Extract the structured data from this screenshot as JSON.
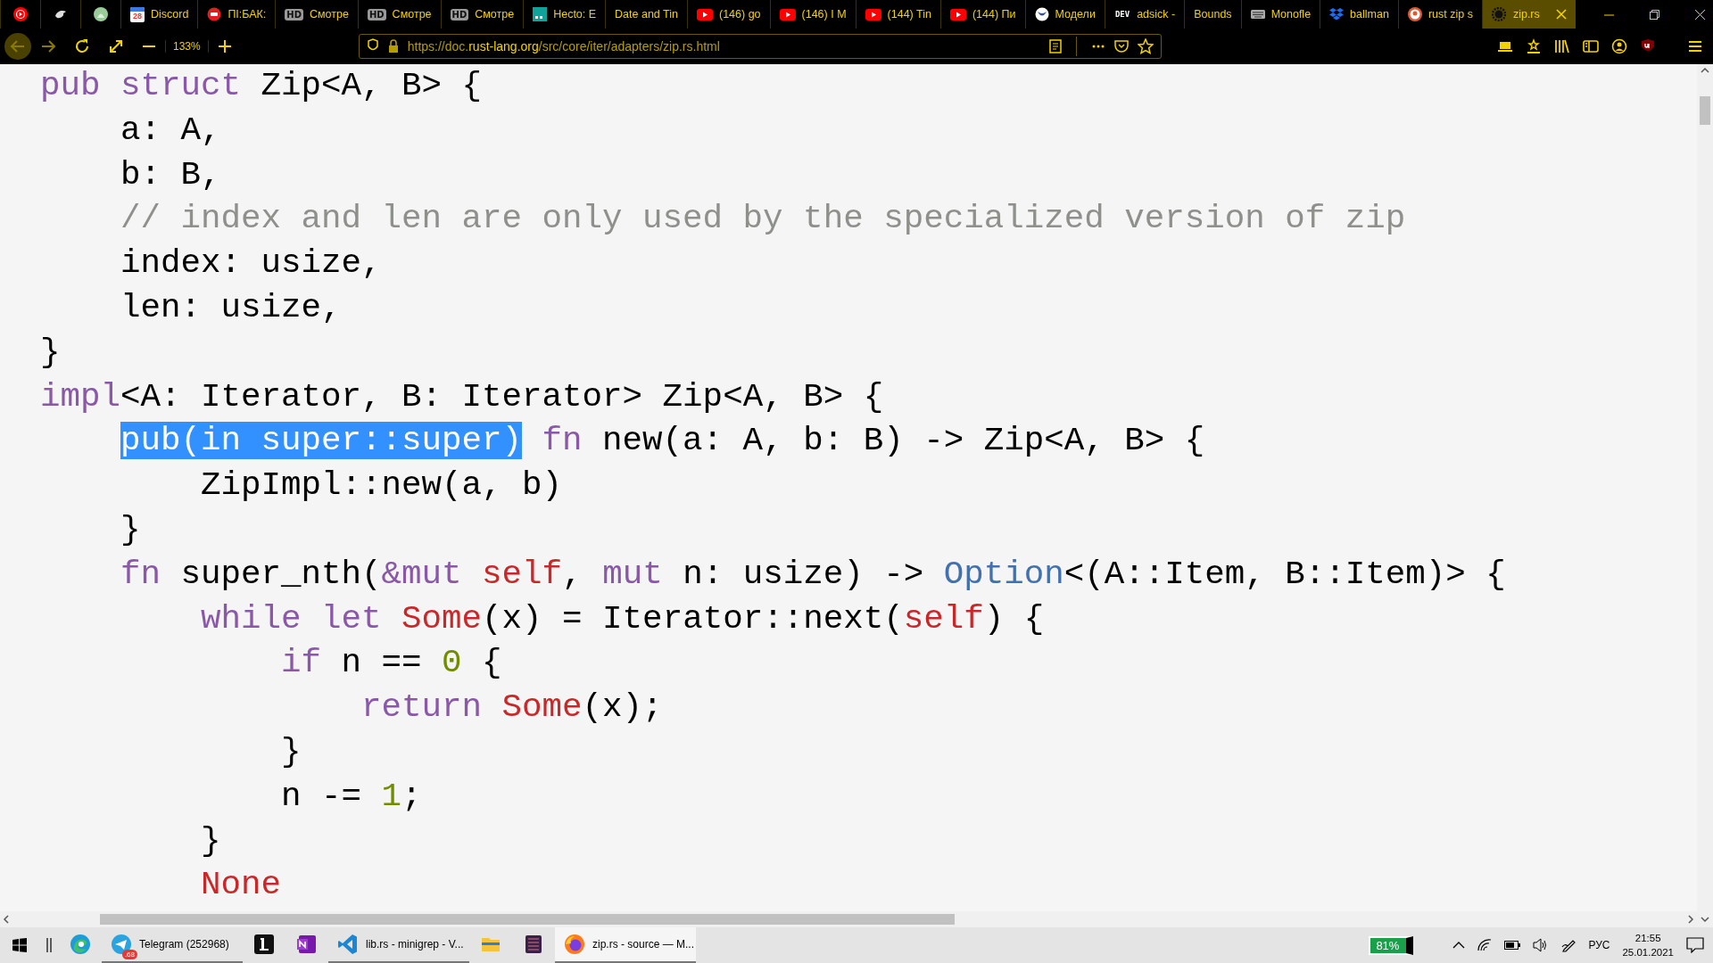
{
  "tabs": [
    {
      "selected": false
    },
    {
      "selected": false
    },
    {
      "selected": false
    },
    {
      "icon_text": "28",
      "title": "Discord",
      "selected": false
    },
    {
      "title": "ПІ:БАК:",
      "selected": false
    },
    {
      "icon_text": "HD",
      "title": "Смотре",
      "selected": false
    },
    {
      "icon_text": "HD",
      "title": "Смотре",
      "selected": false
    },
    {
      "icon_text": "HD",
      "title": "Смотре",
      "selected": false
    },
    {
      "title": "Hecto: E",
      "selected": false
    },
    {
      "title": "Date and Tin",
      "selected": false
    },
    {
      "title": "(146) go",
      "selected": false
    },
    {
      "title": "(146) I M",
      "selected": false
    },
    {
      "title": "(144) Tin",
      "selected": false
    },
    {
      "title": "(144) Пи",
      "selected": false
    },
    {
      "title": "Модели",
      "selected": false
    },
    {
      "icon_text": "DEV",
      "title": "adsick -",
      "selected": false
    },
    {
      "title": "Bounds",
      "selected": false
    },
    {
      "title": "Monofle",
      "selected": false
    },
    {
      "title": "ballman",
      "selected": false
    },
    {
      "title": "rust zip s",
      "selected": false
    },
    {
      "title": "zip.rs",
      "selected": true
    }
  ],
  "nav": {
    "zoom": "133%",
    "url_scheme": "https://doc.",
    "url_domain": "rust-lang.org",
    "url_path": "/src/core/iter/adapters/zip.rs.html"
  },
  "code": [
    {
      "tokens": [
        {
          "kind": "keyword",
          "text": "pub"
        },
        {
          "kind": "keyword",
          "text": " struct"
        },
        {
          "kind": "plain",
          "text": " Zip<A, B> {"
        }
      ],
      "children": [
        {
          "tokens": [
            {
              "kind": "plain",
              "text": "a: A,"
            }
          ]
        },
        {
          "tokens": [
            {
              "kind": "plain",
              "text": "b: B,"
            }
          ]
        },
        {
          "tokens": [
            {
              "kind": "comment",
              "text": "// index and len are only used by the specialized version of zip"
            }
          ]
        },
        {
          "tokens": [
            {
              "kind": "plain",
              "text": "index: usize,"
            }
          ]
        },
        {
          "tokens": [
            {
              "kind": "plain",
              "text": "len: usize,"
            }
          ]
        }
      ]
    },
    {
      "tokens": [
        {
          "kind": "plain",
          "text": "}"
        }
      ]
    },
    {
      "tokens": [
        {
          "kind": "keyword",
          "text": "impl"
        },
        {
          "kind": "plain",
          "text": "<A: Iterator, B: Iterator> Zip<A, B> {"
        }
      ],
      "children": [
        {
          "tokens": [
            {
              "kind": "selected",
              "text": "pub(in super::super)"
            },
            {
              "kind": "keyword",
              "text": " fn"
            },
            {
              "kind": "plain",
              "text": " new(a: A, b: B) -> Zip<A, B> {"
            }
          ],
          "children": [
            {
              "tokens": [
                {
                  "kind": "plain",
                  "text": "ZipImpl::new(a, b)"
                }
              ]
            }
          ]
        },
        {
          "tokens": [
            {
              "kind": "plain",
              "text": "}"
            }
          ]
        },
        {
          "tokens": [
            {
              "kind": "keyword",
              "text": "fn"
            },
            {
              "kind": "plain",
              "text": " super_nth("
            },
            {
              "kind": "keyword",
              "text": "&mut"
            },
            {
              "kind": "self",
              "text": " self"
            },
            {
              "kind": "plain",
              "text": ", "
            },
            {
              "kind": "keyword",
              "text": "mut"
            },
            {
              "kind": "plain",
              "text": " n: usize) -> "
            },
            {
              "kind": "type",
              "text": "Option"
            },
            {
              "kind": "plain",
              "text": "<(A::Item, B::Item)> {"
            }
          ],
          "children": [
            {
              "tokens": [
                {
                  "kind": "keyword",
                  "text": "while"
                },
                {
                  "kind": "keyword",
                  "text": " let"
                },
                {
                  "kind": "variant",
                  "text": " Some"
                },
                {
                  "kind": "plain",
                  "text": "(x) = Iterator::next("
                },
                {
                  "kind": "self",
                  "text": "self"
                },
                {
                  "kind": "plain",
                  "text": ") {"
                }
              ],
              "children": [
                {
                  "tokens": [
                    {
                      "kind": "keyword",
                      "text": "if"
                    },
                    {
                      "kind": "plain",
                      "text": " n == "
                    },
                    {
                      "kind": "number",
                      "text": "0"
                    },
                    {
                      "kind": "plain",
                      "text": " {"
                    }
                  ],
                  "children": [
                    {
                      "tokens": [
                        {
                          "kind": "keyword",
                          "text": "return"
                        },
                        {
                          "kind": "variant",
                          "text": " Some"
                        },
                        {
                          "kind": "plain",
                          "text": "(x);"
                        }
                      ]
                    }
                  ]
                },
                {
                  "tokens": [
                    {
                      "kind": "plain",
                      "text": "}"
                    }
                  ]
                },
                {
                  "tokens": [
                    {
                      "kind": "plain",
                      "text": "n -= "
                    },
                    {
                      "kind": "number",
                      "text": "1"
                    },
                    {
                      "kind": "plain",
                      "text": ";"
                    }
                  ]
                }
              ]
            },
            {
              "tokens": [
                {
                  "kind": "plain",
                  "text": "}"
                }
              ]
            },
            {
              "tokens": [
                {
                  "kind": "variant",
                  "text": "None"
                }
              ]
            }
          ]
        }
      ]
    }
  ],
  "taskbar": {
    "apps": [
      {
        "open": false,
        "active": false
      },
      {
        "label": "Telegram (252968)",
        "badge": ".68",
        "open": true,
        "active": false
      },
      {
        "open": false,
        "active": false
      },
      {
        "open": false,
        "active": false
      },
      {
        "label": "lib.rs - minigrep - V...",
        "open": true,
        "active": false
      },
      {
        "open": false,
        "active": false
      },
      {
        "open": false,
        "active": false
      },
      {
        "label": "zip.rs - source — M...",
        "open": true,
        "active": true
      }
    ],
    "battery_widget": "81%",
    "language": "РУС",
    "time": "21:55",
    "date": "25.01.2021"
  }
}
